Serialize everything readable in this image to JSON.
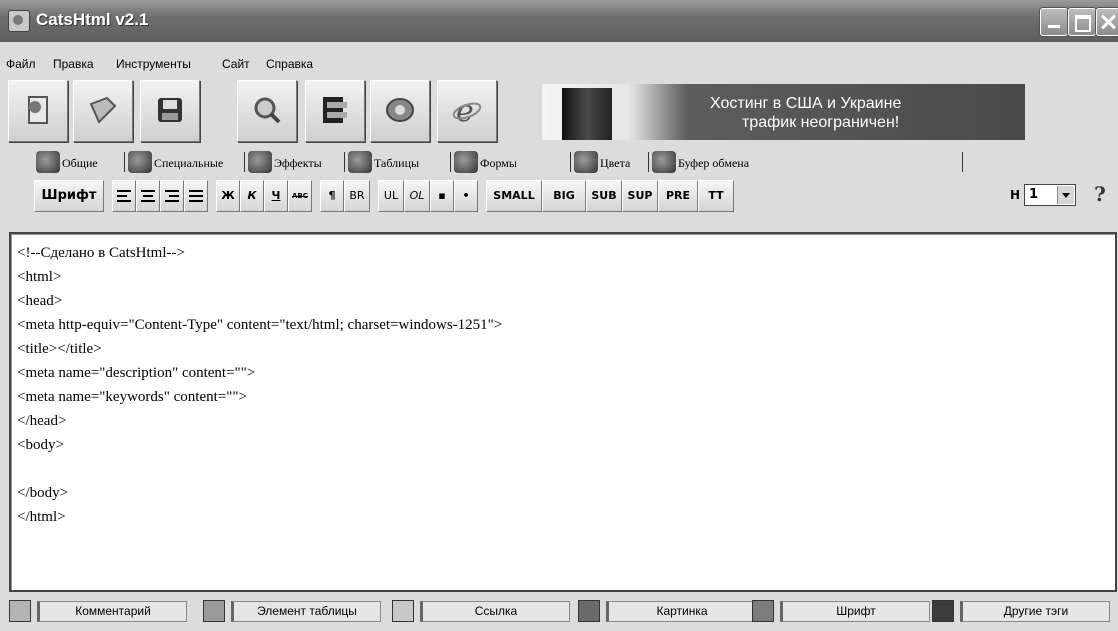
{
  "window": {
    "title": "CatsHtml v2.1"
  },
  "menu": [
    "Файл",
    "Правка",
    "Инструменты",
    "Сайт",
    "Справка"
  ],
  "toolbar_icons": [
    "new-icon",
    "open-icon",
    "save-icon",
    "find-icon",
    "insert-icon",
    "preview-icon",
    "browser-icon"
  ],
  "banner": {
    "line1": "Хостинг в США и Украине",
    "line2": "трафик неограничен!"
  },
  "tabs": [
    "Общие",
    "Специальные",
    "Эффекты",
    "Таблицы",
    "Формы",
    "Цвета",
    "Буфер обмена"
  ],
  "format_toolbar": {
    "font": "Шрифт",
    "bold": "Ж",
    "italic": "К",
    "underline": "Ч",
    "strike": "ABC",
    "para": "¶",
    "br": "BR",
    "ul": "UL",
    "ol": "OL",
    "bullet1": "▪",
    "bullet2": "•",
    "small": "SMALL",
    "big": "BIG",
    "sub": "SUB",
    "sup": "SUP",
    "pre": "PRE",
    "tt": "TT",
    "heading_label": "H",
    "heading_value": "1",
    "help": "?"
  },
  "editor_lines": [
    "<!--Сделано в CatsHtml-->",
    "<html>",
    "<head>",
    "<meta http-equiv=\"Content-Type\" content=\"text/html; charset=windows-1251\">",
    "<title></title>",
    "<meta name=\"description\" content=\"\">",
    "<meta name=\"keywords\" content=\"\">",
    "</head>",
    "<body>",
    "",
    "</body>",
    "</html>"
  ],
  "status_legend": [
    {
      "label": "Комментарий",
      "color": "#b4b4b4"
    },
    {
      "label": "Элемент таблицы",
      "color": "#9a9a9a"
    },
    {
      "label": "Ссылка",
      "color": "#c8c8c8"
    },
    {
      "label": "Картинка",
      "color": "#6a6a6a"
    },
    {
      "label": "Шрифт",
      "color": "#7c7c7c"
    },
    {
      "label": "Другие тэги",
      "color": "#3c3c3c"
    }
  ]
}
